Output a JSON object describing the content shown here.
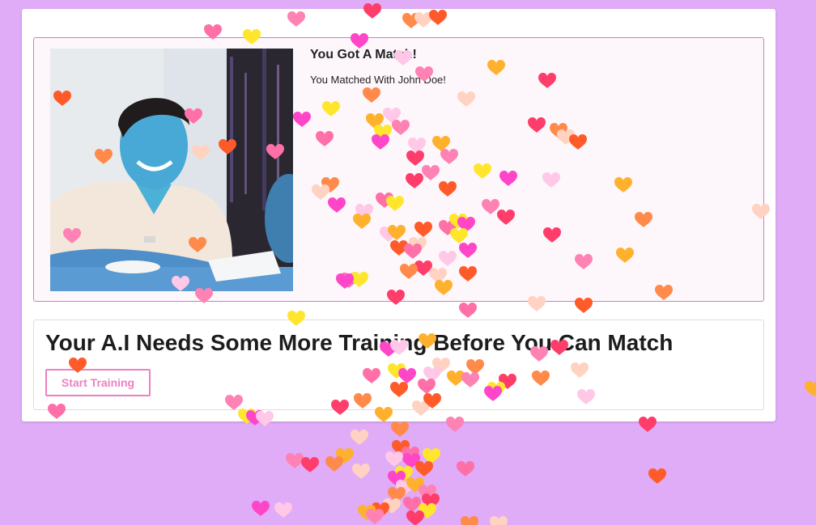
{
  "match": {
    "title": "You Got A Match!",
    "subtitle": "You Matched With John Doe!"
  },
  "training": {
    "heading": "Your A.I Needs Some More Training Before You Can Match",
    "button_label": "Start Training"
  },
  "colors": {
    "page_background": "#e0abf7",
    "panel_border": "#d27bbf",
    "button_accent": "#ee7fc2"
  },
  "heart_palette": [
    "#ff3d6a",
    "#ff5a2a",
    "#ff45c8",
    "#ff82b4",
    "#ffd2c2",
    "#ffe62d",
    "#ffb12e",
    "#ff8a4a",
    "#ff6fa8",
    "#ffc8e6"
  ]
}
